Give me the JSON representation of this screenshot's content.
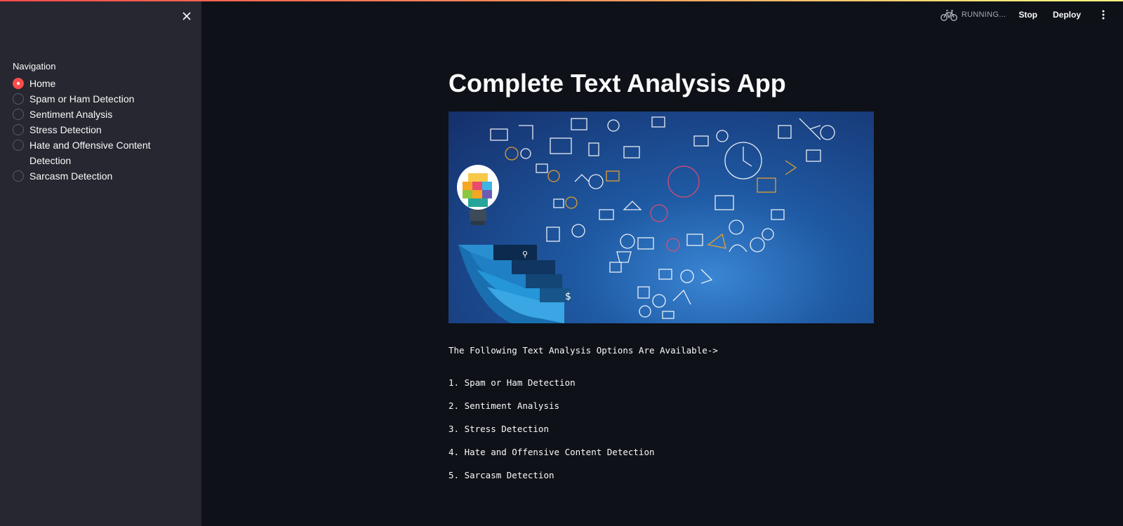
{
  "sidebar": {
    "close_icon": "close-icon",
    "nav_title": "Navigation",
    "options": [
      {
        "label": "Home",
        "checked": true
      },
      {
        "label": "Spam or Ham Detection",
        "checked": false
      },
      {
        "label": "Sentiment Analysis",
        "checked": false
      },
      {
        "label": "Stress Detection",
        "checked": false
      },
      {
        "label": "Hate and Offensive Content Detection",
        "checked": false
      },
      {
        "label": "Sarcasm Detection",
        "checked": false
      }
    ]
  },
  "header": {
    "status": "RUNNING...",
    "status_icon": "bicycle-icon",
    "stop_label": "Stop",
    "deploy_label": "Deploy",
    "menu_icon": "kebab-menu-icon"
  },
  "main": {
    "title": "Complete Text Analysis App",
    "image_alt": "lightbulb-icons-illustration",
    "intro": "The Following Text Analysis Options Are Available->",
    "list": [
      "1. Spam or Ham Detection",
      "2. Sentiment Analysis",
      "3. Stress Detection",
      "4. Hate and Offensive Content Detection",
      "5. Sarcasm Detection"
    ]
  },
  "colors": {
    "accent": "#ff4b4b",
    "sidebar_bg": "#262730",
    "main_bg": "#0e1117"
  }
}
